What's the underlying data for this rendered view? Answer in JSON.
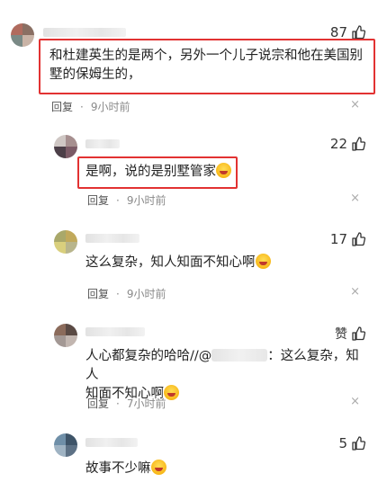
{
  "comments": [
    {
      "text": "和杜建英生的是两个，另外一个儿子说宗和他在美国别墅的保姆生的，",
      "likes": "87",
      "reply_label": "回复",
      "time": "9小时前",
      "close": "×"
    },
    {
      "text": "是啊，说的是别墅管家",
      "likes": "22",
      "reply_label": "回复",
      "time": "9小时前",
      "close": "×"
    },
    {
      "text": "这么复杂，知人知面不知心啊",
      "likes": "17",
      "reply_label": "回复",
      "time": "9小时前",
      "close": "×"
    },
    {
      "text_a": "人心都复杂的哈哈//@",
      "text_b": "：这么复杂，知人",
      "text_c": "知面不知心啊",
      "likes": "赞",
      "reply_label": "回复",
      "time": "7小时前",
      "close": "×"
    },
    {
      "text": "故事不少嘛",
      "likes": "5",
      "reply_label": "",
      "time": "",
      "close": "×"
    }
  ],
  "colors": {
    "highlight_box": "#e23232",
    "meta_text": "#8a8a8a"
  },
  "icons": {
    "like": "thumbs-up-icon",
    "close": "close-icon",
    "emoji": "laughing-emoji-icon"
  }
}
